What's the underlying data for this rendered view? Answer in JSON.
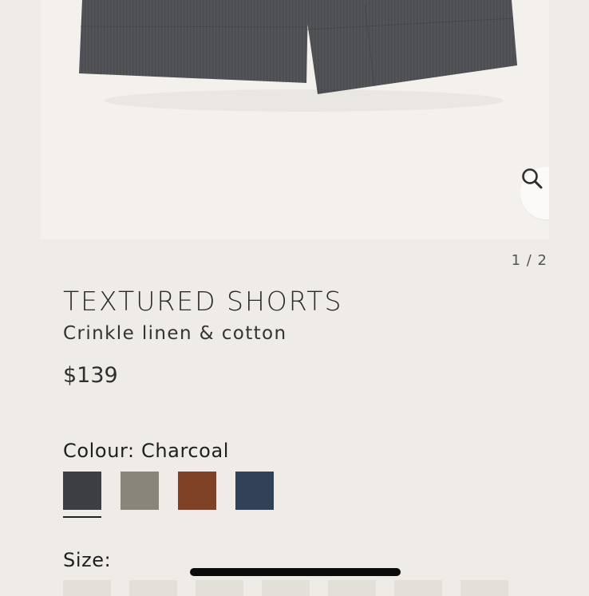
{
  "gallery": {
    "pager_text": "1 / 2",
    "zoom_icon": "magnifier-icon"
  },
  "product": {
    "title": "TEXTURED SHORTS",
    "subtitle": "Crinkle linen & cotton",
    "price": "$139"
  },
  "colour": {
    "label": "Colour: Charcoal",
    "swatches": [
      {
        "name": "Charcoal",
        "color": "#3c3e44",
        "selected": true
      },
      {
        "name": "Taupe",
        "color": "#8a857b",
        "selected": false
      },
      {
        "name": "Rust",
        "color": "#7e4326",
        "selected": false
      },
      {
        "name": "Navy",
        "color": "#334158",
        "selected": false
      }
    ]
  },
  "size": {
    "label": "Size:"
  }
}
